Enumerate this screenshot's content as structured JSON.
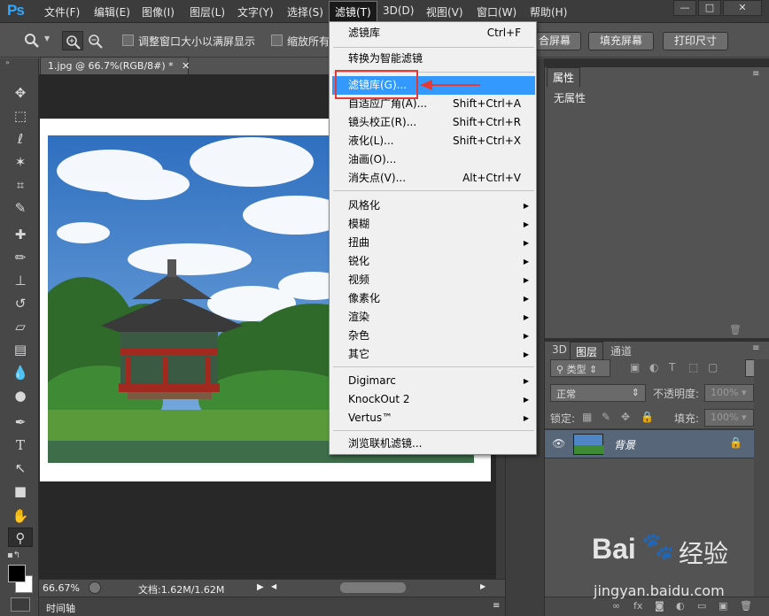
{
  "menubar": {
    "logo": "Ps",
    "items": [
      {
        "label": "文件(F)"
      },
      {
        "label": "编辑(E)"
      },
      {
        "label": "图像(I)"
      },
      {
        "label": "图层(L)"
      },
      {
        "label": "文字(Y)"
      },
      {
        "label": "选择(S)"
      },
      {
        "label": "滤镜(T)"
      },
      {
        "label": "3D(D)"
      },
      {
        "label": "视图(V)"
      },
      {
        "label": "窗口(W)"
      },
      {
        "label": "帮助(H)"
      }
    ],
    "window_buttons": [
      "—",
      "□",
      "✕"
    ]
  },
  "options_bar": {
    "resize_windows_label": "调整窗口大小以满屏显示",
    "zoom_all_label": "缩放所有",
    "fit_screen_label": "合屏幕",
    "fill_screen_label": "填充屏幕",
    "print_size_label": "打印尺寸"
  },
  "document": {
    "tab_title": "1.jpg @ 66.7%(RGB/8#) *",
    "zoom": "66.67%",
    "doc_info": "文档:1.62M/1.62M",
    "timeline_label": "时间轴"
  },
  "filter_menu": {
    "items": [
      {
        "label": "滤镜库",
        "shortcut": "Ctrl+F"
      },
      {
        "label": "转换为智能滤镜",
        "shortcut": ""
      },
      {
        "label": "滤镜库(G)...",
        "shortcut": ""
      },
      {
        "label": "自适应广角(A)...",
        "shortcut": "Shift+Ctrl+A"
      },
      {
        "label": "镜头校正(R)...",
        "shortcut": "Shift+Ctrl+R"
      },
      {
        "label": "液化(L)...",
        "shortcut": "Shift+Ctrl+X"
      },
      {
        "label": "油画(O)...",
        "shortcut": ""
      },
      {
        "label": "消失点(V)...",
        "shortcut": "Alt+Ctrl+V"
      },
      {
        "label": "风格化",
        "shortcut": ""
      },
      {
        "label": "模糊",
        "shortcut": ""
      },
      {
        "label": "扭曲",
        "shortcut": ""
      },
      {
        "label": "锐化",
        "shortcut": ""
      },
      {
        "label": "视频",
        "shortcut": ""
      },
      {
        "label": "像素化",
        "shortcut": ""
      },
      {
        "label": "渲染",
        "shortcut": ""
      },
      {
        "label": "杂色",
        "shortcut": ""
      },
      {
        "label": "其它",
        "shortcut": ""
      },
      {
        "label": "Digimarc",
        "shortcut": ""
      },
      {
        "label": "KnockOut 2",
        "shortcut": ""
      },
      {
        "label": "Vertus™",
        "shortcut": ""
      },
      {
        "label": "浏览联机滤镜...",
        "shortcut": ""
      }
    ]
  },
  "properties_panel": {
    "tab": "属性",
    "content": "无属性"
  },
  "layers_panel": {
    "tabs": [
      "3D",
      "图层",
      "通道"
    ],
    "filter_kind": "类型",
    "blend_mode": "正常",
    "opacity_label": "不透明度:",
    "opacity_value": "100%",
    "lock_label": "锁定:",
    "fill_label": "填充:",
    "fill_value": "100%",
    "layer_name": "背景"
  },
  "watermark": {
    "brand": "Bai",
    "brand_cn": "经验",
    "url": "jingyan.baidu.com"
  },
  "colors": {
    "highlight": "#3399ff",
    "annotation": "#e53935"
  }
}
